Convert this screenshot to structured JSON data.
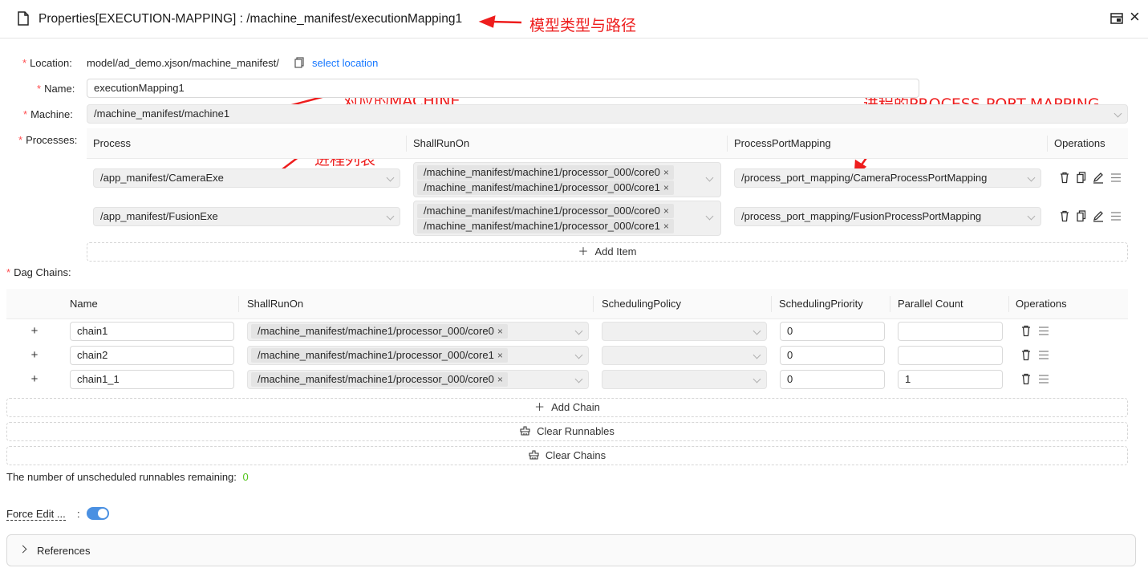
{
  "header": {
    "title": "Properties[EXECUTION-MAPPING] : /machine_manifest/executionMapping1"
  },
  "annotations": {
    "type_path": "模型类型与路径",
    "machine": "对应的MACHINE",
    "process_list": "进程列表",
    "ppm": "进程的PROCESS-PORT-MAPPING"
  },
  "form": {
    "location_label": "Location",
    "location_value": "model/ad_demo.xjson/machine_manifest/",
    "select_location": "select location",
    "name_label": "Name",
    "name_value": "executionMapping1",
    "machine_label": "Machine",
    "machine_value": "/machine_manifest/machine1",
    "processes_label": "Processes",
    "colon": ":"
  },
  "processes": {
    "headers": [
      "Process",
      "ShallRunOn",
      "ProcessPortMapping",
      "Operations"
    ],
    "rows": [
      {
        "process": "/app_manifest/CameraExe",
        "cores": [
          "/machine_manifest/machine1/processor_000/core0",
          "/machine_manifest/machine1/processor_000/core1"
        ],
        "ppm": "/process_port_mapping/CameraProcessPortMapping"
      },
      {
        "process": "/app_manifest/FusionExe",
        "cores": [
          "/machine_manifest/machine1/processor_000/core0",
          "/machine_manifest/machine1/processor_000/core1"
        ],
        "ppm": "/process_port_mapping/FusionProcessPortMapping"
      }
    ],
    "add_item": "Add Item"
  },
  "dag": {
    "label": "Dag Chains",
    "headers": [
      "Name",
      "ShallRunOn",
      "SchedulingPolicy",
      "SchedulingPriority",
      "Parallel Count",
      "Operations"
    ],
    "rows": [
      {
        "expand": "+",
        "name": "chain1",
        "core": "/machine_manifest/machine1/processor_000/core0",
        "policy": "",
        "priority": "0",
        "parallel": ""
      },
      {
        "expand": "+",
        "name": "chain2",
        "core": "/machine_manifest/machine1/processor_000/core1",
        "policy": "",
        "priority": "0",
        "parallel": ""
      },
      {
        "expand": "+",
        "name": "chain1_1",
        "core": "/machine_manifest/machine1/processor_000/core0",
        "policy": "",
        "priority": "0",
        "parallel": "1"
      }
    ],
    "add_chain": "Add Chain",
    "clear_runnables": "Clear Runnables",
    "clear_chains": "Clear Chains"
  },
  "status": {
    "unscheduled_label": "The number of unscheduled runnables remaining:",
    "unscheduled_value": "0",
    "unscheduled_color": "#52c41a"
  },
  "force_edit": {
    "label": "Force Edit ...",
    "colon": ":",
    "enabled": true
  },
  "references": {
    "label": "References"
  },
  "icons": {
    "close": "×",
    "tag_remove": "×",
    "plus": "+"
  }
}
